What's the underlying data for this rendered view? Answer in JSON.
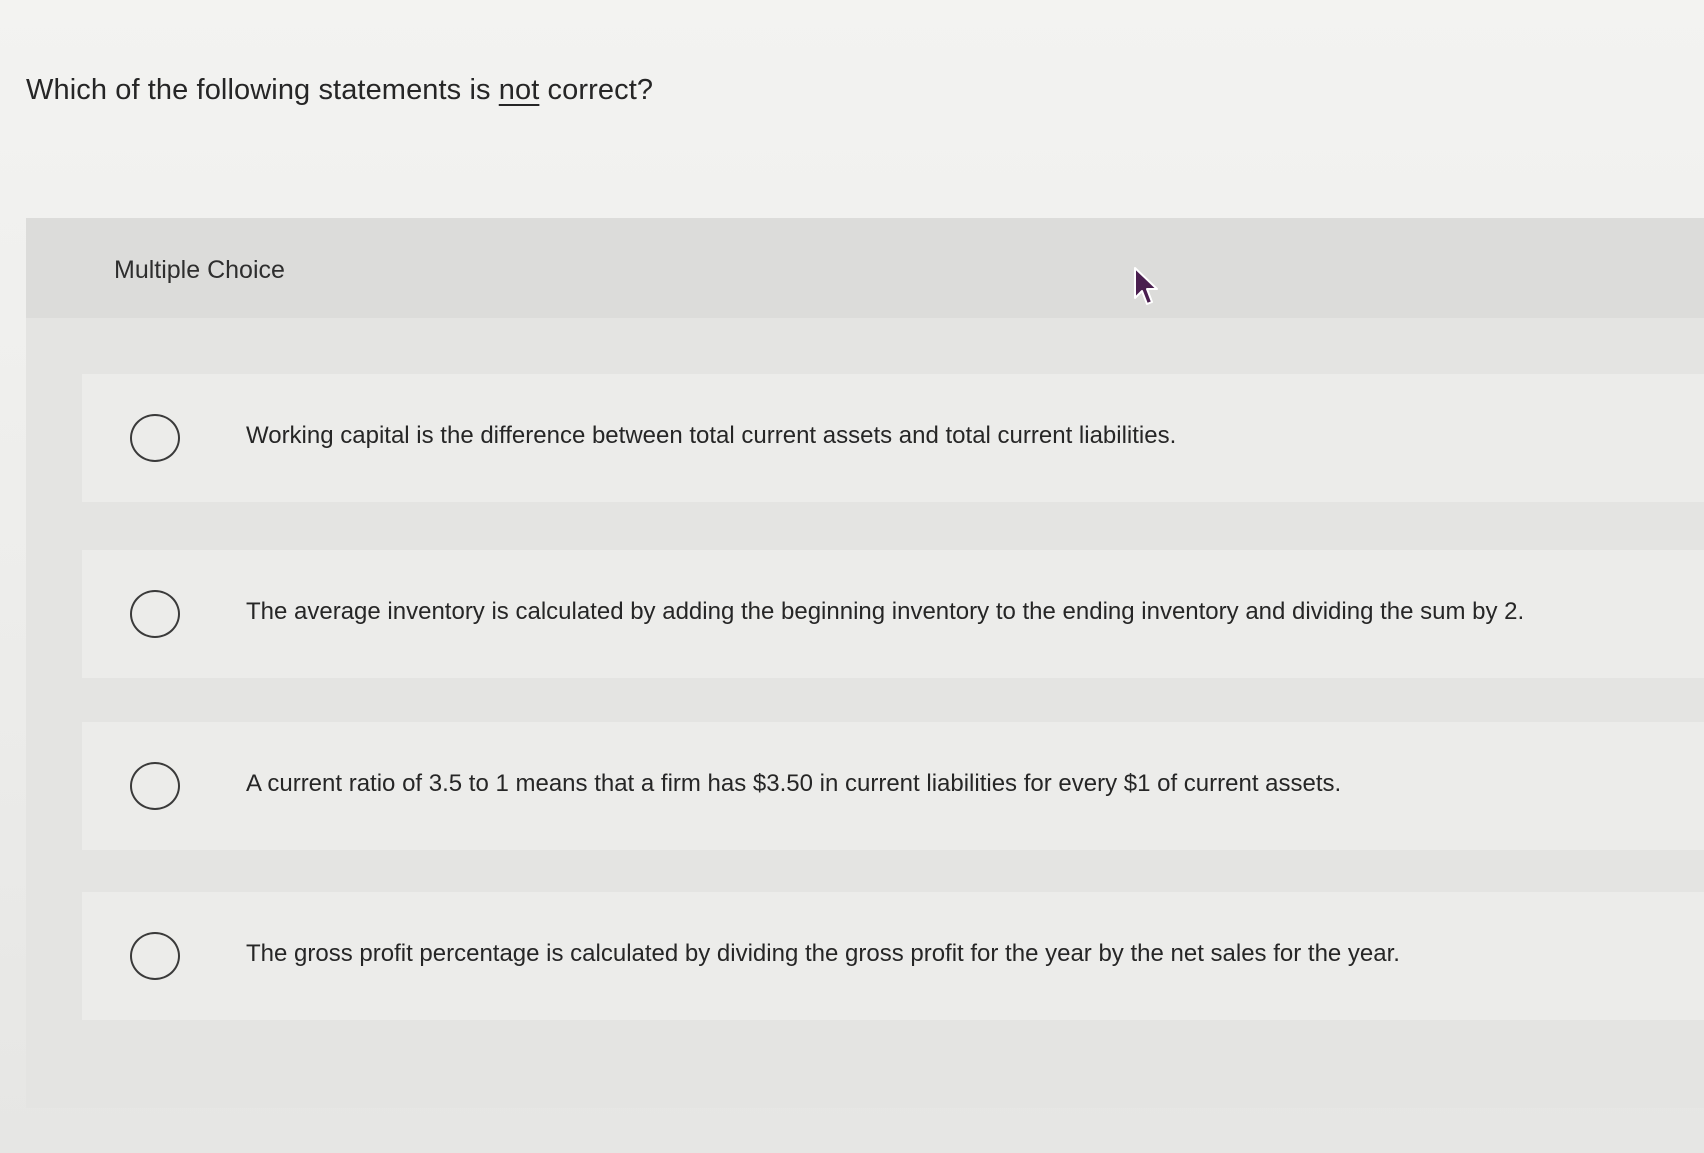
{
  "question": {
    "prefix": "Which of the following statements is ",
    "emphasis": "not",
    "suffix": " correct?"
  },
  "panel": {
    "title": "Multiple Choice"
  },
  "options": [
    {
      "label": "Working capital is the difference between total current assets and total current liabilities."
    },
    {
      "label": "The average inventory is calculated by adding the beginning inventory to the ending inventory and dividing the sum by 2."
    },
    {
      "label": "A current ratio of 3.5 to 1 means that a firm has $3.50 in current liabilities for every $1 of current assets."
    },
    {
      "label": "The gross profit percentage is calculated by dividing the gross profit for the year by the net sales for the year."
    }
  ],
  "icons": {
    "cursor": "mouse-pointer-icon",
    "radio": "radio-unselected-icon"
  }
}
